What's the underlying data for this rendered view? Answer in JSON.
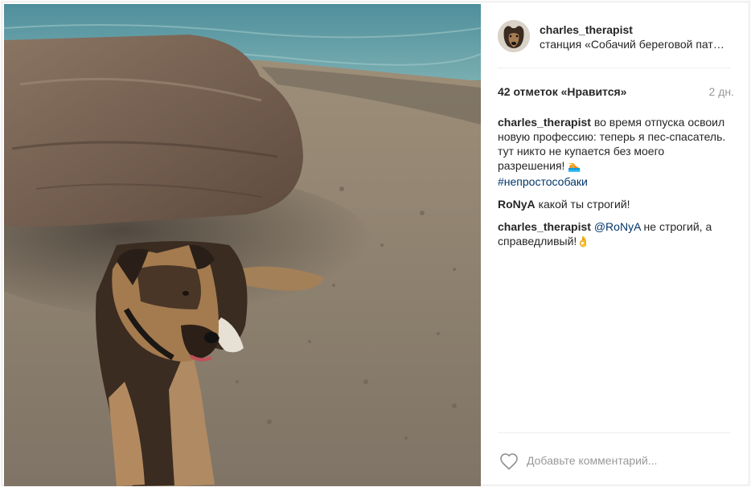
{
  "post": {
    "username": "charles_therapist",
    "location": "станция «Собачий береговой пат…",
    "likes": "42 отметок «Нравится»",
    "time": "2 дн."
  },
  "comments": [
    {
      "author": "charles_therapist",
      "text": "во время отпуска освоил новую профессию: теперь я пес-спасатель. тут никто не купается без моего разрешения!",
      "emoji": "🏊",
      "hashtag": "#непростособаки"
    },
    {
      "author": "RoNyA",
      "text": "какой ты строгий!"
    },
    {
      "author": "charles_therapist",
      "mention": "@RoNyA",
      "text": "не строгий, а справедливый!",
      "emoji": "👌"
    }
  ],
  "footer": {
    "comment_placeholder": "Добавьте комментарий..."
  },
  "icons": {
    "like": "heart-icon"
  },
  "colors": {
    "link": "#003569",
    "muted": "#999999",
    "border": "#efefef"
  }
}
